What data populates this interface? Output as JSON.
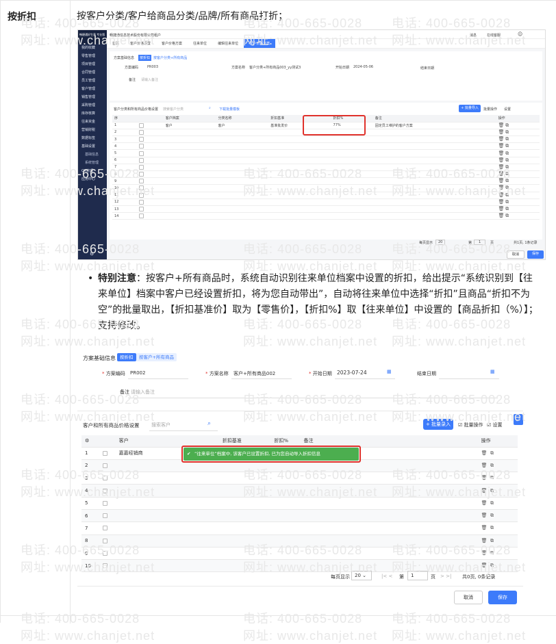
{
  "row": {
    "label": "按折扣",
    "description": "按客户分类/客户给商品分类/品牌/所有商品打折；"
  },
  "watermark": {
    "phone": "电话: 400-665-0028",
    "site": "网址: www.chanjet.net"
  },
  "shot1": {
    "brand": "畅捷通好生意 专业版",
    "org": "畅捷通信息技术股份有限公司租户",
    "top_right": [
      "消息",
      "在线客服"
    ],
    "sidebar": [
      "我的收藏",
      "零售管理",
      "项目管理",
      "合同管理",
      "员工管理",
      "客户管理",
      "销售管理",
      "采购管理",
      "库存核算",
      "往来资金",
      "营销财税",
      "数据标签",
      "基础设置",
      "基础信息",
      "系统管理",
      "OA管理",
      "应用中心"
    ],
    "tabs": [
      "首页",
      "客户价格设置",
      "客户价格方案",
      "往来单位",
      "编辑往来单位",
      "客户价格方案"
    ],
    "section_title": "方案基础信息",
    "tag1": "按折扣",
    "tag2": "按客户分类+所有商品",
    "code_label": "方案编码",
    "code_value": "PR003",
    "name_label": "方案名称",
    "name_value": "客户分类+所有商品003_yy测试3",
    "start_label": "开始日期",
    "start_value": "2024-05-06",
    "end_label": "结束日期",
    "remark_label": "备注",
    "remark_placeholder": "请输入备注",
    "grid_title": "客户分类和所有商品价格设置",
    "grid_search": "搜索客户分类",
    "grid_link": "下载批量模板",
    "btn_batch_import": "+ 批量导入",
    "btn_batch_op": "批量操作",
    "btn_settings": "设置",
    "columns": [
      "序",
      "",
      "客户档案",
      "分类名称",
      "折扣基准",
      "折扣%",
      "备注",
      "操作"
    ],
    "row1": [
      "1",
      "",
      "客户",
      "客户",
      "基准批发价",
      "77%",
      "固定员工维护的客户方案"
    ],
    "row_count": 14,
    "page_size_label": "每页显示",
    "page_size": "20",
    "page_label": "第",
    "page": "1",
    "page_suffix": "页",
    "total": "共1页, 1条记录",
    "cancel": "取消",
    "save": "保存"
  },
  "bullet": {
    "bold": "特别注意",
    "text": "：按客户+所有商品时，系统自动识别往来单位档案中设置的折扣，给出提示“系统识别到【往来单位】档案中客户已经设置折扣，将为您自动带出”，自动将往来单位中选择“折扣”且商品“折扣不为空”的批量取出，【折扣基准价】取为【零售价】，【折扣%】取【往来单位】中设置的【商品折扣（%）】；支持修改。"
  },
  "shot2": {
    "section_title": "方案基础信息",
    "tag1": "按折扣",
    "tag2": "按客户+所有商品",
    "code_label": "方案编码",
    "code_value": "PR002",
    "name_label": "方案名称",
    "name_value": "客户+所有商品002",
    "start_label": "开始日期",
    "start_value": "2023-07-24",
    "end_label": "结束日期",
    "remark_label": "备注",
    "remark_placeholder": "请输入备注",
    "grid_title": "客户和所有商品价格设置",
    "grid_search": "搜索客户",
    "btn_batch_import": "+ 批量录入",
    "btn_batch_op": "批量操作",
    "btn_settings": "设置",
    "columns": [
      "⚙",
      "",
      "客户",
      "折扣基准",
      "折扣%",
      "备注",
      "操作"
    ],
    "row1_customer": "嘉嘉经销商",
    "toast": "“往来单位”档案中, 该客户已设置折扣, 已为您自动导入折扣信息",
    "rows": [
      "1",
      "2",
      "3",
      "4",
      "5",
      "6",
      "7",
      "8",
      "9",
      "10"
    ],
    "page_size_label": "每页显示",
    "page_size": "20",
    "page_label": "第",
    "page": "1",
    "page_suffix": "页",
    "total": "共0页, 0条记录",
    "cancel": "取消",
    "save": "保存"
  }
}
